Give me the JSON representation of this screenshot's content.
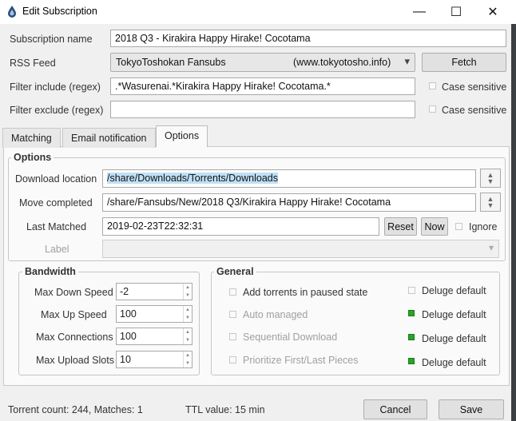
{
  "window": {
    "title": "Edit Subscription",
    "minimize_glyph": "—",
    "maximize_glyph": "☐",
    "close_glyph": "✕"
  },
  "top": {
    "subscription_name_label": "Subscription name",
    "subscription_name_value": "2018 Q3 - Kirakira Happy Hirake! Cocotama",
    "rss_feed_label": "RSS Feed",
    "rss_feed_name": "TokyoToshokan Fansubs",
    "rss_feed_url": "(www.tokyotosho.info)",
    "fetch_label": "Fetch",
    "filter_include_label": "Filter include (regex)",
    "filter_include_value": ".*Wasurenai.*Kirakira Happy Hirake! Cocotama.*",
    "filter_exclude_label": "Filter exclude (regex)",
    "filter_exclude_value": "",
    "case_sensitive_label": "Case sensitive"
  },
  "tabs": [
    {
      "label": "Matching"
    },
    {
      "label": "Email notification"
    },
    {
      "label": "Options"
    }
  ],
  "options": {
    "group_title": "Options",
    "download_location_label": "Download location",
    "download_location_value": "/share/Downloads/Torrents/Downloads",
    "move_completed_label": "Move completed",
    "move_completed_value": "/share/Fansubs/New/2018 Q3/Kirakira Happy Hirake! Cocotama",
    "last_matched_label": "Last Matched",
    "last_matched_value": "2019-02-23T22:32:31",
    "reset_label": "Reset",
    "now_label": "Now",
    "ignore_label": "Ignore",
    "label_label": "Label",
    "label_value": ""
  },
  "bandwidth": {
    "title": "Bandwidth",
    "rows": [
      {
        "label": "Max Down Speed",
        "value": "-2"
      },
      {
        "label": "Max Up Speed",
        "value": "100"
      },
      {
        "label": "Max Connections",
        "value": "100"
      },
      {
        "label": "Max Upload Slots",
        "value": "10"
      }
    ]
  },
  "general": {
    "title": "General",
    "rows": [
      {
        "label": "Add torrents in paused state",
        "default_label": "Deluge default"
      },
      {
        "label": "Auto managed",
        "default_label": "Deluge default"
      },
      {
        "label": "Sequential Download",
        "default_label": "Deluge default"
      },
      {
        "label": "Prioritize First/Last Pieces",
        "default_label": "Deluge default"
      }
    ]
  },
  "status": {
    "torrent_count": "Torrent count: 244, Matches: 1",
    "ttl": "TTL value: 15 min"
  },
  "buttons": {
    "cancel_label": "Cancel",
    "save_label": "Save"
  },
  "colors": {
    "selection": "#bfe0f5",
    "deluge_default_green": "#27a52a"
  }
}
